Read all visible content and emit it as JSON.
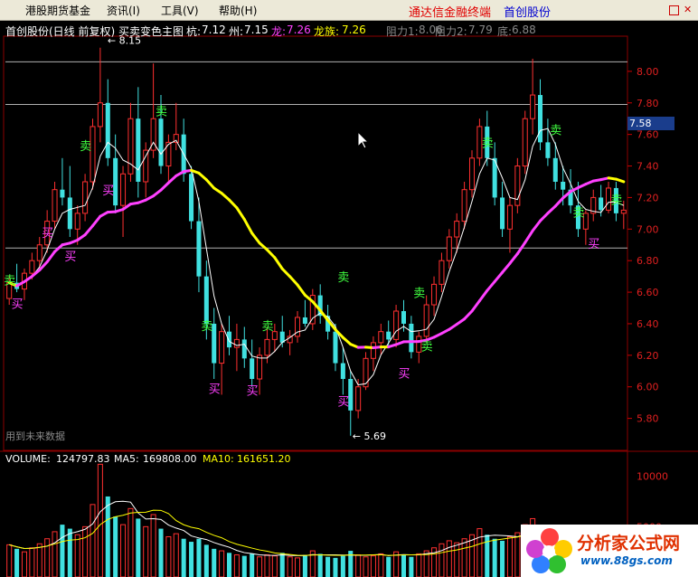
{
  "menubar": {
    "items": [
      "港股期货基金",
      "资讯(I)",
      "工具(V)",
      "帮助(H)"
    ],
    "app_title": "通达信金融终端",
    "stock_name": "首创股份"
  },
  "main_info": {
    "title": "首创股份(日线 前复权) 买卖变色主图",
    "hang_label": "杭:",
    "hang_value": "7.12",
    "zhou_label": "州:",
    "zhou_value": "7.15",
    "long_label": "龙:",
    "long_value": "7.26",
    "longzu_label": "龙族:",
    "longzu_value": "7.26",
    "zuli1_label": "阻力1:",
    "zuli1_value": "8.06",
    "zuli2_label": "阻力2:",
    "zuli2_value": "7.79",
    "di_label": "底:",
    "di_value": "6.88"
  },
  "vol_info": {
    "volume_label": "VOLUME:",
    "volume_value": "124797.83",
    "ma5_label": "MA5:",
    "ma5_value": "169808.00",
    "ma10_label": "MA10:",
    "ma10_value": "161651.20"
  },
  "price_axis": [
    "8.00",
    "7.80",
    "7.60",
    "7.40",
    "7.20",
    "7.00",
    "6.80",
    "6.60",
    "6.40",
    "6.20",
    "6.00",
    "5.80"
  ],
  "current_price_tag": "7.58",
  "volume_axis": [
    "10000",
    "5000"
  ],
  "annotations": {
    "high": "8.15",
    "low": "5.69"
  },
  "future_note": "用到未来数据",
  "buy_label": "买",
  "sell_label": "卖",
  "watermark": {
    "text": "分析家公式网",
    "url": "www.88gs.com"
  },
  "colors": {
    "up": "#ff3030",
    "down": "#40e0e0",
    "yellow": "#ffff00",
    "magenta": "#ff40ff",
    "white": "#ffffff",
    "sell": "#40ff40",
    "buy": "#ff40ff"
  },
  "chart_data": {
    "type": "candlestick",
    "ylim": [
      5.62,
      8.2
    ],
    "resistance_lines": [
      8.06,
      7.79,
      6.88
    ],
    "bars": [
      [
        6.56,
        6.7,
        6.52,
        6.66
      ],
      [
        6.66,
        6.78,
        6.6,
        6.62
      ],
      [
        6.62,
        6.75,
        6.55,
        6.72
      ],
      [
        6.72,
        6.85,
        6.68,
        6.8
      ],
      [
        6.8,
        6.95,
        6.75,
        6.9
      ],
      [
        6.9,
        7.12,
        6.85,
        7.05
      ],
      [
        7.05,
        7.3,
        7.0,
        7.25
      ],
      [
        7.25,
        7.45,
        7.15,
        7.2
      ],
      [
        7.2,
        7.4,
        6.95,
        7.0
      ],
      [
        7.0,
        7.15,
        6.9,
        7.1
      ],
      [
        7.1,
        7.35,
        7.05,
        7.3
      ],
      [
        7.3,
        7.7,
        7.25,
        7.65
      ],
      [
        7.65,
        8.15,
        7.55,
        7.8
      ],
      [
        7.8,
        7.95,
        7.4,
        7.45
      ],
      [
        7.45,
        7.6,
        7.1,
        7.15
      ],
      [
        7.15,
        7.4,
        6.95,
        7.35
      ],
      [
        7.35,
        7.8,
        7.3,
        7.7
      ],
      [
        7.7,
        7.9,
        7.2,
        7.3
      ],
      [
        7.3,
        7.55,
        7.2,
        7.5
      ],
      [
        7.5,
        8.05,
        7.45,
        7.7
      ],
      [
        7.7,
        7.85,
        7.35,
        7.4
      ],
      [
        7.4,
        7.6,
        7.3,
        7.55
      ],
      [
        7.55,
        7.8,
        7.5,
        7.6
      ],
      [
        7.6,
        7.7,
        7.3,
        7.35
      ],
      [
        7.35,
        7.4,
        7.0,
        7.05
      ],
      [
        7.05,
        7.2,
        6.6,
        6.7
      ],
      [
        6.7,
        6.8,
        6.3,
        6.4
      ],
      [
        6.4,
        6.5,
        6.05,
        6.15
      ],
      [
        6.15,
        6.4,
        5.95,
        6.35
      ],
      [
        6.35,
        6.45,
        6.2,
        6.25
      ],
      [
        6.25,
        6.4,
        6.1,
        6.3
      ],
      [
        6.3,
        6.38,
        6.12,
        6.18
      ],
      [
        6.18,
        6.3,
        6.0,
        6.05
      ],
      [
        6.05,
        6.25,
        5.95,
        6.2
      ],
      [
        6.2,
        6.38,
        6.15,
        6.3
      ],
      [
        6.3,
        6.4,
        6.22,
        6.35
      ],
      [
        6.35,
        6.45,
        6.25,
        6.28
      ],
      [
        6.28,
        6.36,
        6.2,
        6.32
      ],
      [
        6.32,
        6.48,
        6.28,
        6.44
      ],
      [
        6.44,
        6.55,
        6.38,
        6.4
      ],
      [
        6.4,
        6.62,
        6.36,
        6.58
      ],
      [
        6.58,
        6.65,
        6.4,
        6.45
      ],
      [
        6.45,
        6.52,
        6.3,
        6.35
      ],
      [
        6.35,
        6.4,
        6.1,
        6.15
      ],
      [
        6.15,
        6.25,
        5.95,
        6.05
      ],
      [
        6.05,
        6.1,
        5.69,
        5.85
      ],
      [
        5.85,
        6.05,
        5.8,
        6.0
      ],
      [
        6.0,
        6.22,
        5.98,
        6.18
      ],
      [
        6.18,
        6.32,
        6.1,
        6.28
      ],
      [
        6.28,
        6.4,
        6.2,
        6.35
      ],
      [
        6.35,
        6.42,
        6.25,
        6.3
      ],
      [
        6.3,
        6.52,
        6.25,
        6.48
      ],
      [
        6.48,
        6.55,
        6.35,
        6.4
      ],
      [
        6.4,
        6.45,
        6.18,
        6.22
      ],
      [
        6.22,
        6.35,
        6.15,
        6.32
      ],
      [
        6.32,
        6.58,
        6.28,
        6.52
      ],
      [
        6.52,
        6.7,
        6.45,
        6.65
      ],
      [
        6.65,
        6.85,
        6.6,
        6.8
      ],
      [
        6.8,
        7.0,
        6.75,
        6.95
      ],
      [
        6.95,
        7.1,
        6.85,
        7.05
      ],
      [
        7.05,
        7.3,
        7.0,
        7.25
      ],
      [
        7.25,
        7.5,
        7.2,
        7.45
      ],
      [
        7.45,
        7.7,
        7.4,
        7.65
      ],
      [
        7.65,
        7.75,
        7.4,
        7.45
      ],
      [
        7.45,
        7.55,
        7.15,
        7.2
      ],
      [
        7.2,
        7.3,
        6.95,
        7.0
      ],
      [
        7.0,
        7.2,
        6.85,
        7.15
      ],
      [
        7.15,
        7.45,
        7.1,
        7.4
      ],
      [
        7.4,
        7.75,
        7.35,
        7.7
      ],
      [
        7.7,
        8.08,
        7.6,
        7.85
      ],
      [
        7.85,
        7.95,
        7.5,
        7.55
      ],
      [
        7.55,
        7.7,
        7.4,
        7.45
      ],
      [
        7.45,
        7.55,
        7.25,
        7.3
      ],
      [
        7.3,
        7.4,
        7.15,
        7.25
      ],
      [
        7.25,
        7.38,
        7.1,
        7.15
      ],
      [
        7.15,
        7.3,
        6.95,
        7.0
      ],
      [
        7.0,
        7.12,
        6.9,
        7.1
      ],
      [
        7.1,
        7.25,
        7.05,
        7.2
      ],
      [
        7.2,
        7.28,
        7.08,
        7.12
      ],
      [
        7.12,
        7.3,
        7.1,
        7.26
      ],
      [
        7.26,
        7.3,
        7.05,
        7.1
      ],
      [
        7.1,
        7.18,
        7.0,
        7.12
      ]
    ],
    "volume": [
      3200,
      2800,
      2500,
      2900,
      3300,
      3800,
      4500,
      5200,
      4800,
      4200,
      5000,
      7200,
      11200,
      8000,
      6000,
      5200,
      6800,
      5800,
      5000,
      6200,
      4800,
      4000,
      4300,
      3800,
      3500,
      3800,
      3200,
      2800,
      2600,
      2400,
      2200,
      2100,
      2300,
      2000,
      2200,
      2100,
      2400,
      2000,
      1900,
      2200,
      2600,
      2300,
      2000,
      1900,
      2100,
      2600,
      2200,
      2000,
      2100,
      2300,
      2000,
      2500,
      2200,
      2000,
      2300,
      2600,
      2900,
      3300,
      3600,
      3400,
      3800,
      4200,
      4800,
      4200,
      3800,
      3600,
      4000,
      4400,
      5200,
      5800,
      5000,
      4400,
      3900,
      3600,
      3400,
      3800,
      3300,
      3200,
      3100,
      3400,
      3000,
      2800
    ]
  }
}
